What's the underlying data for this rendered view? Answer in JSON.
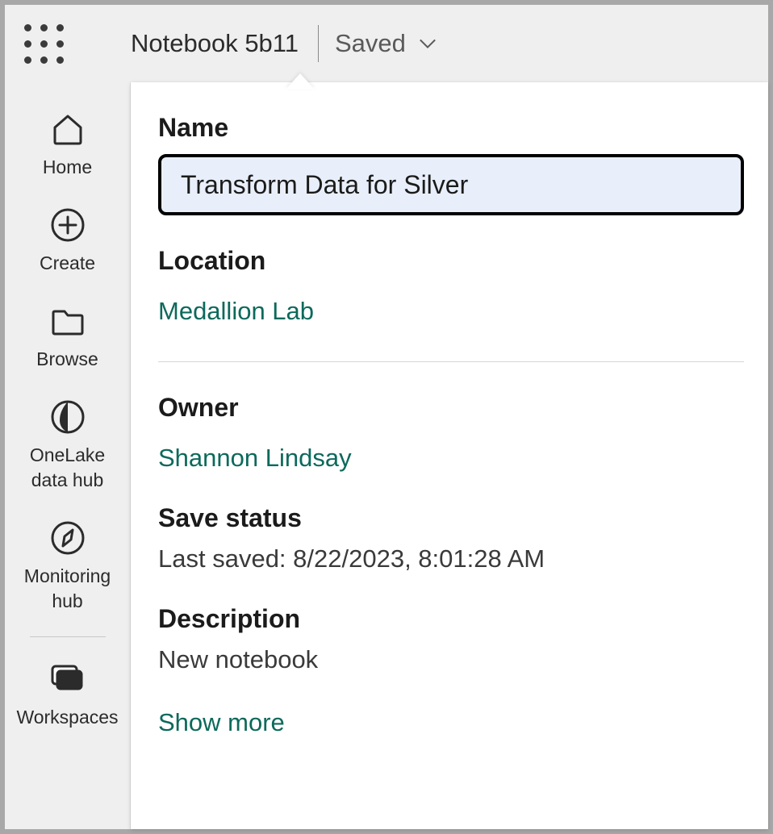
{
  "header": {
    "notebook_title": "Notebook 5b11",
    "saved_label": "Saved"
  },
  "sidebar": {
    "items": [
      {
        "label": "Home"
      },
      {
        "label": "Create"
      },
      {
        "label": "Browse"
      },
      {
        "label": "OneLake data hub"
      },
      {
        "label": "Monitoring hub"
      },
      {
        "label": "Workspaces"
      }
    ]
  },
  "panel": {
    "name_label": "Name",
    "name_value": "Transform Data for Silver",
    "location_label": "Location",
    "location_value": "Medallion Lab",
    "owner_label": "Owner",
    "owner_value": "Shannon Lindsay",
    "save_status_label": "Save status",
    "save_status_value": "Last saved: 8/22/2023, 8:01:28 AM",
    "description_label": "Description",
    "description_value": "New notebook",
    "show_more_label": "Show more"
  }
}
